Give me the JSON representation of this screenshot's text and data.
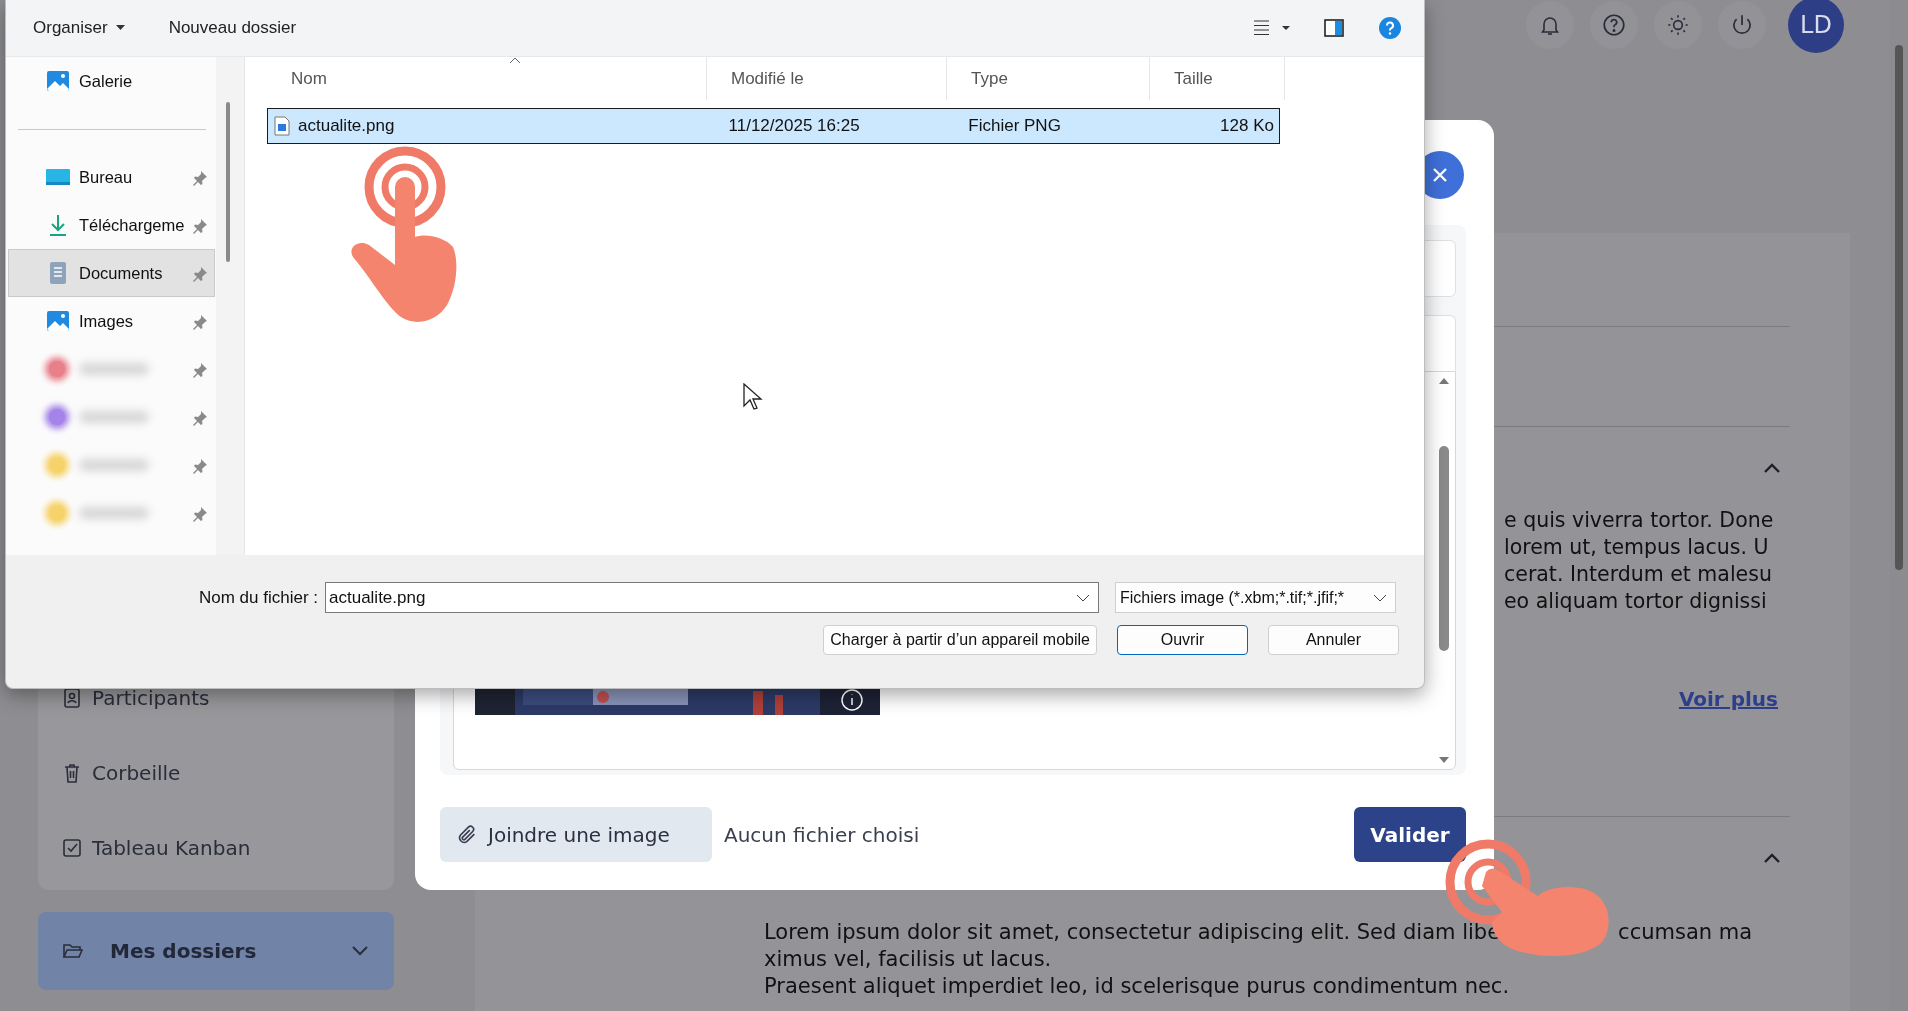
{
  "header": {
    "avatar": "LD"
  },
  "sidebar": {
    "items": [
      {
        "label": "Participants",
        "kind": "participants"
      },
      {
        "label": "Corbeille",
        "kind": "trash"
      },
      {
        "label": "Tableau Kanban",
        "kind": "kanban"
      }
    ],
    "folder": {
      "label": "Mes dossiers",
      "expanded": false
    }
  },
  "content": {
    "sections": [
      {
        "expanded": true,
        "lines": [
          "e quis viverra tortor. Done",
          "lorem ut, tempus lacus. U",
          "cerat. Interdum et malesu",
          "eo aliquam tortor dignissi"
        ],
        "link": "Voir plus"
      },
      {
        "expanded": true,
        "first_line": [
          "Lorem ipsum dolor sit amet, consectetur adipiscing elit. Sed diam libe",
          "ccumsan ma"
        ],
        "lines": [
          "ximus vel, facilisis ut lacus.",
          "Praesent aliquet imperdiet leo, id scelerisque purus condimentum nec."
        ]
      }
    ]
  },
  "modal": {
    "attach_button": "Joindre une image",
    "file_status": "Aucun fichier choisi",
    "submit": "Valider"
  },
  "file_dialog": {
    "toolbar": {
      "organize": "Organiser",
      "new_folder": "Nouveau dossier"
    },
    "nav": [
      {
        "label": "Galerie",
        "kind": "gallery",
        "pinned": false,
        "selected": false
      },
      {
        "kind": "divider"
      },
      {
        "label": "Bureau",
        "kind": "desktop",
        "pinned": true,
        "selected": false
      },
      {
        "label": "Téléchargeme",
        "kind": "download",
        "pinned": true,
        "selected": false
      },
      {
        "label": "Documents",
        "kind": "documents",
        "pinned": true,
        "selected": true
      },
      {
        "label": "Images",
        "kind": "images",
        "pinned": true,
        "selected": false
      },
      {
        "kind": "blurred",
        "color": "#e8808a",
        "pinned": true,
        "selected": false
      },
      {
        "kind": "blurred",
        "color": "#a484e8",
        "pinned": true,
        "selected": false
      },
      {
        "kind": "blurred",
        "color": "#f6d36a",
        "pinned": true,
        "selected": false
      },
      {
        "kind": "blurred",
        "color": "#f6d36a",
        "pinned": true,
        "selected": false
      }
    ],
    "columns": [
      "Nom",
      "Modifié le",
      "Type",
      "Taille"
    ],
    "files": [
      {
        "name": "actualite.png",
        "modified": "11/12/2025 16:25",
        "type": "Fichier PNG",
        "size": "128 Ko",
        "selected": true
      }
    ],
    "filename_label": "Nom du fichier :",
    "filename": "actualite.png",
    "filter": "Fichiers image (*.xbm;*.tif;*.jfif;*",
    "buttons": [
      {
        "label": "Charger à partir d’un appareil mobile",
        "kind": "normal"
      },
      {
        "label": "Ouvrir",
        "kind": "default"
      },
      {
        "label": "Annuler",
        "kind": "normal"
      }
    ]
  }
}
